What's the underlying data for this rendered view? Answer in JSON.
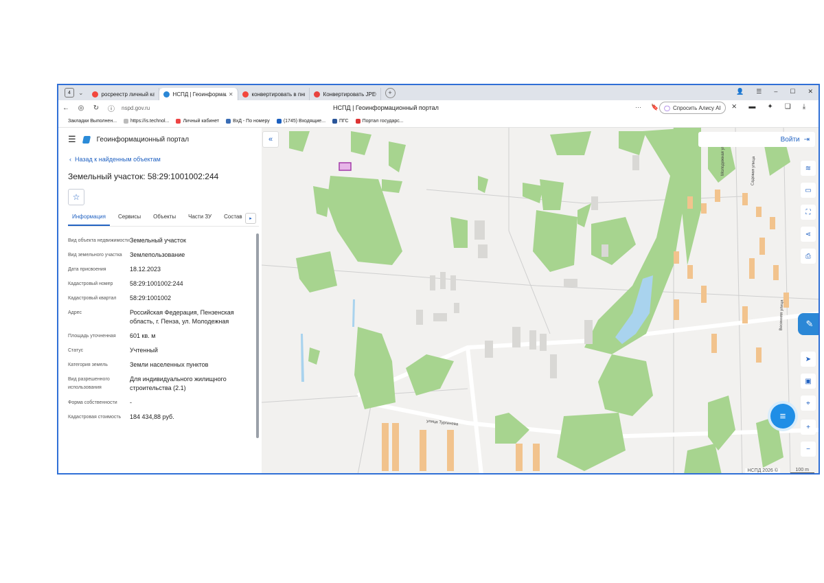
{
  "browser": {
    "tab_count": "4",
    "tabs": [
      {
        "label": "росреестр личный кабинет",
        "color": "#f2473d"
      },
      {
        "label": "НСПД | Геоинформационный портал",
        "color": "#2b87d6"
      },
      {
        "label": "конвертировать в пнг — Я",
        "color": "#f2473d"
      },
      {
        "label": "Конвертировать JPEG в P",
        "color": "#e8433f"
      }
    ],
    "url": "nspd.gov.ru",
    "page_title": "НСПД | Геоинформационный портал",
    "alice_label": "Спросить Алису AI"
  },
  "bookmarks": [
    "Закладки Выполнен...",
    "https://is.technol...",
    "Личный кабинет",
    "ВхД - По номеру",
    "(1745) Входящие...",
    "ПГС",
    "Портал государс..."
  ],
  "panel": {
    "portal_name": "Геоинформационный портал",
    "back_label": "Назад к найденным объектам",
    "title": "Земельный участок: 58:29:1001002:244",
    "tabs": [
      "Информация",
      "Сервисы",
      "Объекты",
      "Части ЗУ",
      "Состав"
    ],
    "rows": [
      {
        "key": "Вид объекта недвижимости",
        "value": "Земельный участок"
      },
      {
        "key": "Вид земельного участка",
        "value": "Землепользование"
      },
      {
        "key": "Дата присвоения",
        "value": "18.12.2023"
      },
      {
        "key": "Кадастровый номер",
        "value": "58:29:1001002:244"
      },
      {
        "key": "Кадастровый квартал",
        "value": "58:29:1001002"
      },
      {
        "key": "Адрес",
        "value": "Российская Федерация, Пензенская область, г. Пенза, ул. Молодежная"
      },
      {
        "key": "Площадь уточненная",
        "value": "601 кв. м"
      },
      {
        "key": "Статус",
        "value": "Учтенный"
      },
      {
        "key": "Категория земель",
        "value": "Земли населенных пунктов"
      },
      {
        "key": "Вид разрешенного использования",
        "value": "Для индивидуального жилищного строительства (2.1)"
      },
      {
        "key": "Форма собственности",
        "value": "-"
      },
      {
        "key": "Кадастровая стоимость",
        "value": "184 434,88 руб."
      }
    ]
  },
  "map": {
    "login_label": "Войти",
    "copyright": "НСПД 2026 ©",
    "scale": "100 m",
    "streets": [
      "улица Тургенева",
      "Молодежная улица",
      "Садовая улица",
      "Весенняя улица"
    ],
    "colors": {
      "green": "#a7d48f",
      "water": "#a9d3ee",
      "building": "#d9d8d5",
      "house": "#f2c38d",
      "road": "#ffffff",
      "accent": "#2162c2"
    }
  }
}
